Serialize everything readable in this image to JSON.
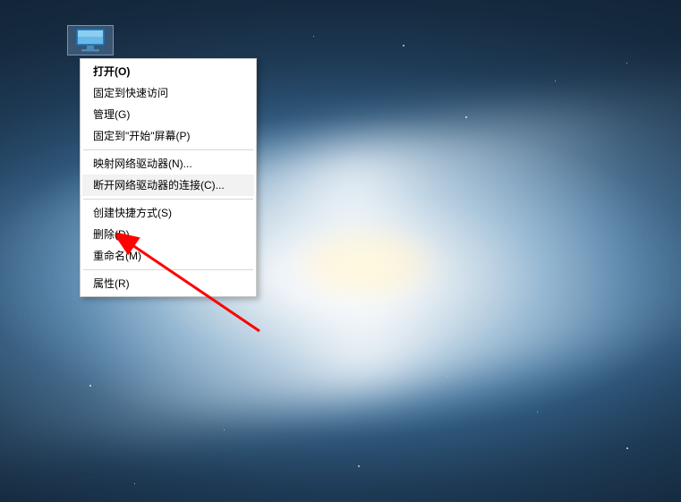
{
  "desktop": {
    "icon_name": "this-pc"
  },
  "context_menu": {
    "groups": [
      [
        {
          "label": "打开(O)",
          "bold": true
        },
        {
          "label": "固定到快速访问"
        },
        {
          "label": "管理(G)"
        },
        {
          "label": "固定到\"开始\"屏幕(P)"
        }
      ],
      [
        {
          "label": "映射网络驱动器(N)..."
        },
        {
          "label": "断开网络驱动器的连接(C)...",
          "hover": true
        }
      ],
      [
        {
          "label": "创建快捷方式(S)"
        },
        {
          "label": "删除(D)"
        },
        {
          "label": "重命名(M)"
        }
      ],
      [
        {
          "label": "属性(R)"
        }
      ]
    ]
  }
}
